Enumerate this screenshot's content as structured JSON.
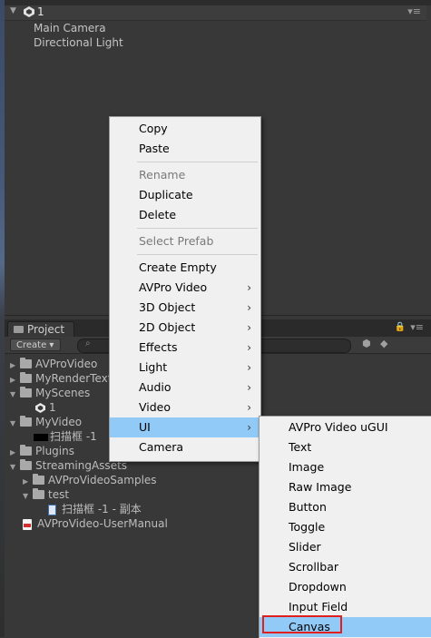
{
  "hierarchy": {
    "scene_name": "1",
    "objects": [
      "Main Camera",
      "Directional Light"
    ]
  },
  "project": {
    "tab_label": "Project",
    "create_label": "Create ▾",
    "tree": [
      {
        "label": "AVProVideo"
      },
      {
        "label": "MyRenderTexture"
      },
      {
        "label": "MyScenes"
      },
      {
        "label": "1"
      },
      {
        "label": "MyVideo"
      },
      {
        "label": "扫描框 -1"
      },
      {
        "label": "Plugins"
      },
      {
        "label": "StreamingAssets"
      },
      {
        "label": "AVProVideoSamples"
      },
      {
        "label": "test"
      },
      {
        "label": "扫描框 -1 - 副本"
      },
      {
        "label": "AVProVideo-UserManual"
      }
    ]
  },
  "context_menu": {
    "items": [
      "Copy",
      "Paste",
      "Rename",
      "Duplicate",
      "Delete",
      "Select Prefab",
      "Create Empty",
      "AVPro Video",
      "3D Object",
      "2D Object",
      "Effects",
      "Light",
      "Audio",
      "Video",
      "UI",
      "Camera"
    ],
    "submenu_arrow": "›"
  },
  "ui_submenu": {
    "items": [
      "AVPro Video uGUI",
      "Text",
      "Image",
      "Raw Image",
      "Button",
      "Toggle",
      "Slider",
      "Scrollbar",
      "Dropdown",
      "Input Field",
      "Canvas"
    ]
  }
}
